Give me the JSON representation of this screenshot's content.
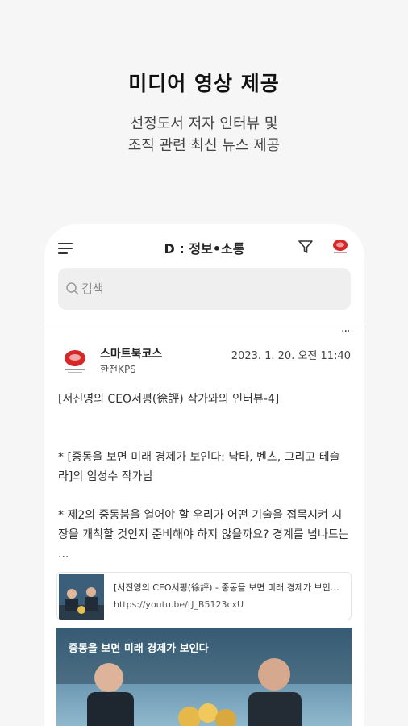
{
  "promo": {
    "title": "미디어 영상 제공",
    "subtitle_line1": "선정도서 저자 인터뷰 및",
    "subtitle_line2": "조직 관련 최신 뉴스 제공"
  },
  "app": {
    "title": "D : 정보•소통",
    "icons": {
      "menu": "menu-icon",
      "filter": "filter-icon",
      "brand": "brand-logo-icon"
    }
  },
  "search": {
    "placeholder": "검색"
  },
  "post": {
    "more": "···",
    "author": "스마트북코스",
    "org": "한전KPS",
    "datetime": "2023. 1. 20. 오전 11:40",
    "body": "[서진영의 CEO서평(徐評) 작가와의 인터뷰-4]\n\n\n* [중동을 보면 미래 경제가 보인다: 낙타, 벤츠, 그리고 테슬라]의 임성수 작가님\n\n* 제2의 중동붐을 열어야 할 우리가 어떤 기술을 접목시켜 시장을 개척할 것인지 준비해야 하지 않을까요? 경계를 넘나드는 ..."
  },
  "link_card": {
    "title": "[서진영의 CEO서평(徐評) - 중동을 보면 미래 경제가 보인다 - 낙타, 벤츠, 그리고 테슬라]",
    "url": "https://youtu.be/tJ_B5123cxU"
  },
  "video": {
    "title": "중동을 보면 미래 경제가 보인다"
  },
  "colors": {
    "brand_red": "#d62828",
    "background": "#f6f6f6"
  }
}
